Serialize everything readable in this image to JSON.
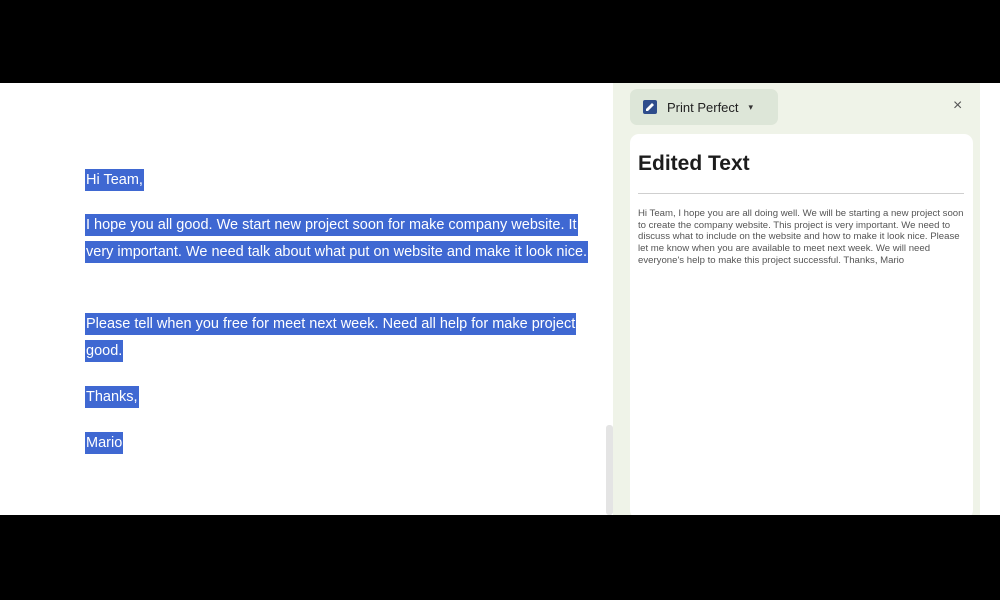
{
  "document": {
    "greeting": "Hi Team,",
    "paragraph1": "I hope you all good. We start new project soon for make company website. It very important. We need talk about what put on website and make it look nice.",
    "paragraph2": "Please tell when you free for meet next week. Need all help for make project good.",
    "closing": "Thanks,",
    "signature": "Mario"
  },
  "panel": {
    "tool_label": "Print Perfect",
    "tool_icon": "edit-icon",
    "caret_icon": "caret-down-icon",
    "close_icon": "close-icon",
    "close_glyph": "×",
    "caret_glyph": "▾",
    "card_title": "Edited Text",
    "edited_text": "Hi Team, I hope you are all doing well. We will be starting a new project soon to create the company website. This project is very important. We need to discuss what to include on the website and how to make it look nice. Please let me know when you are available to meet next week. We will need everyone's help to make this project successful. Thanks, Mario"
  },
  "colors": {
    "selection": "#3f68d2",
    "panel_bg": "#eff3e8",
    "chip_bg": "#dde6d8",
    "letterbox": "#000000"
  }
}
